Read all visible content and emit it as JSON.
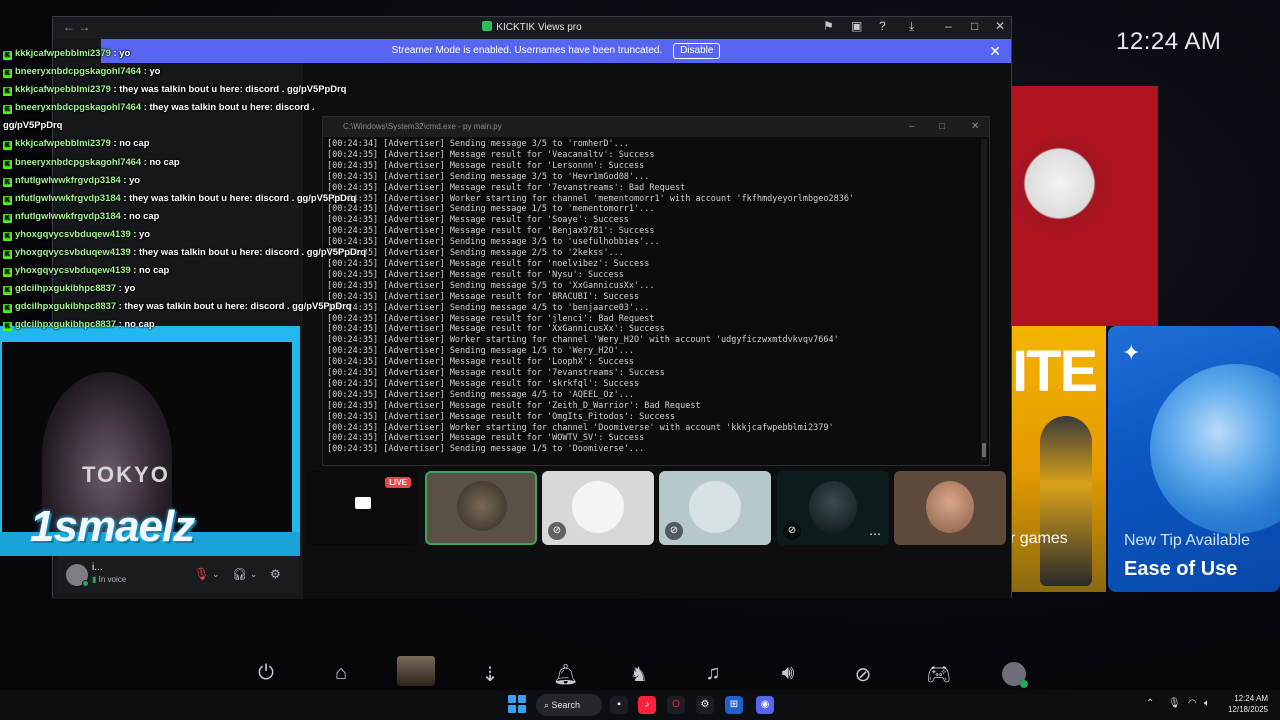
{
  "desktop": {
    "clock": "12:24 AM"
  },
  "tiles": {
    "fortnite_text": "ITE",
    "fortnite_games": "r games",
    "tip_small": "New Tip Available",
    "tip_big": "Ease of Use"
  },
  "discord": {
    "title": "KICKTIK Views pro",
    "banner_text": "Streamer Mode is enabled. Usernames have been truncated.",
    "banner_button": "Disable",
    "voice": {
      "name": "i...",
      "status": "In voice"
    }
  },
  "cmd": {
    "title": "C:\\Windows\\System32\\cmd.exe - py  main.py",
    "lines": [
      "[00:24:34] [Advertiser] Sending message 3/5 to 'romherD'...",
      "[00:24:35] [Advertiser] Message result for 'Veacanaltv': Success",
      "[00:24:35] [Advertiser] Message result for 'Lersonnn': Success",
      "[00:24:35] [Advertiser] Sending message 3/5 to 'Hevr1mGod08'...",
      "[00:24:35] [Advertiser] Message result for '7evanstreams': Bad Request",
      "[00:24:35] [Advertiser] Worker starting for channel 'mementomorr1' with account 'fkfhmdyeyorlmbgeo2836'",
      "[00:24:35] [Advertiser] Sending message 1/5 to 'mementomorr1'...",
      "[00:24:35] [Advertiser] Message result for 'Soaye': Success",
      "[00:24:35] [Advertiser] Message result for 'Benjax9781': Success",
      "[00:24:35] [Advertiser] Sending message 3/5 to 'usefulhobbies'...",
      "[00:24:35] [Advertiser] Sending message 2/5 to '2kekss'...",
      "[00:24:35] [Advertiser] Message result for 'noelvibez': Success",
      "[00:24:35] [Advertiser] Message result for 'Nysu': Success",
      "[00:24:35] [Advertiser] Sending message 5/5 to 'XxGannicusXx'...",
      "[00:24:35] [Advertiser] Message result for 'BRACUBI': Success",
      "[00:24:35] [Advertiser] Sending message 4/5 to 'benjaarce03'...",
      "[00:24:35] [Advertiser] Message result for 'jlenci': Bad Request",
      "[00:24:35] [Advertiser] Message result for 'XxGannicusXx': Success",
      "[00:24:35] [Advertiser] Worker starting for channel 'Wery_H2O' with account 'udgyficzwxmtdvkvqv7664'",
      "[00:24:35] [Advertiser] Sending message 1/5 to 'Wery_H2O'...",
      "[00:24:35] [Advertiser] Message result for 'LoophX': Success",
      "[00:24:35] [Advertiser] Message result for '7evanstreams': Success",
      "[00:24:35] [Advertiser] Message result for 'skrkfql': Success",
      "[00:24:35] [Advertiser] Sending message 4/5 to 'AQEEL_Oz'...",
      "[00:24:35] [Advertiser] Message result for 'Zeith_D_Warrior': Bad Request",
      "[00:24:35] [Advertiser] Message result for 'OmgIts_Pitodos': Success",
      "[00:24:35] [Advertiser] Worker starting for channel 'Doomiverse' with account 'kkkjcafwpebblmi2379'",
      "[00:24:35] [Advertiser] Message result for 'WOWTV_SV': Success",
      "[00:24:35] [Advertiser] Sending message 1/5 to 'Doomiverse'..."
    ]
  },
  "participants": {
    "live_badge": "LIVE"
  },
  "chat": [
    {
      "user": "kkkjcafwpebblmi2379",
      "msg": "yo"
    },
    {
      "user": "bneeryxnbdcpgskagohl7464",
      "msg": "yo"
    },
    {
      "user": "kkkjcafwpebblmi2379",
      "msg": "they was talkin bout u here: discord . gg/pV5PpDrq"
    },
    {
      "user": "bneeryxnbdcpgskagohl7464",
      "msg": "they was talkin bout u here: discord ."
    },
    {
      "user": "",
      "msg": "gg/pV5PpDrq"
    },
    {
      "user": "kkkjcafwpebblmi2379",
      "msg": "no cap"
    },
    {
      "user": "bneeryxnbdcpgskagohl7464",
      "msg": "no cap"
    },
    {
      "user": "nfutlgwlwwkfrgvdp3184",
      "msg": "yo"
    },
    {
      "user": "nfutlgwlwwkfrgvdp3184",
      "msg": "they was talkin bout u here: discord . gg/pV5PpDrq"
    },
    {
      "user": "nfutlgwlwwkfrgvdp3184",
      "msg": "no cap"
    },
    {
      "user": "yhoxgqvycsvbduqew4139",
      "msg": "yo"
    },
    {
      "user": "yhoxgqvycsvbduqew4139",
      "msg": "they was talkin bout u here: discord . gg/pV5PpDrq"
    },
    {
      "user": "yhoxgqvycsvbduqew4139",
      "msg": "no cap"
    },
    {
      "user": "gdcilhpxgukibhpc8837",
      "msg": "yo"
    },
    {
      "user": "gdcilhpxgukibhpc8837",
      "msg": "they was talkin bout u here: discord . gg/pV5PpDrq"
    },
    {
      "user": "gdcilhpxgukibhpc8837",
      "msg": "no cap"
    }
  ],
  "webcam": {
    "overlay_name": "1smaelz",
    "shirt_text": "TOKYO"
  },
  "taskbar": {
    "search": "Search",
    "time": "12:24 AM",
    "date": "12/18/2025"
  }
}
